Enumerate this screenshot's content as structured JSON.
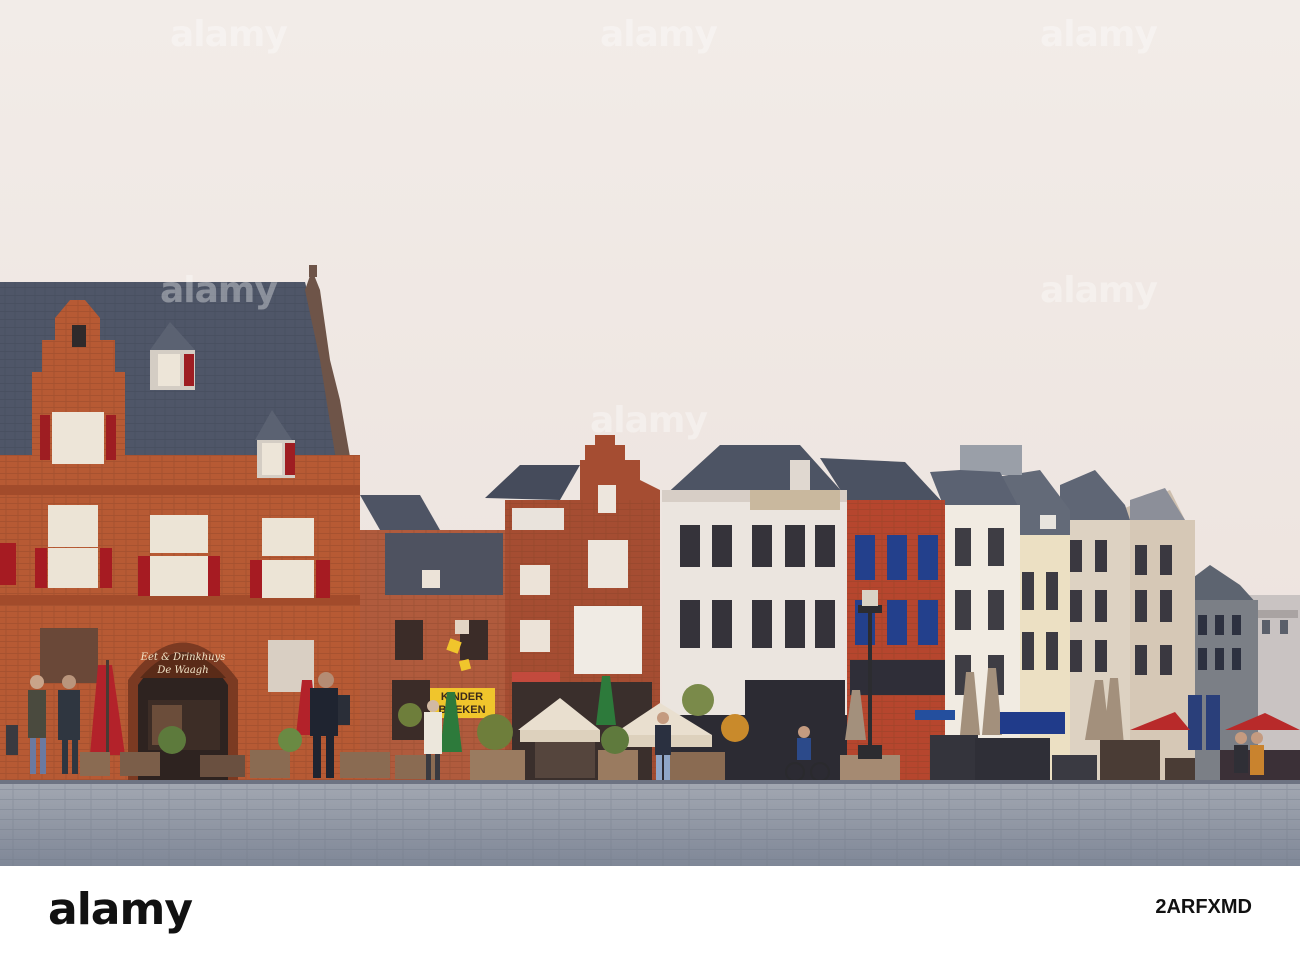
{
  "photo": {
    "sky_color": "#efe7e2",
    "pavement_color": "#8d95a4",
    "signs": {
      "restaurant_arch_line1": "Eet & Drinkhuys",
      "restaurant_arch_line2": "De Waagh",
      "kinder_line1": "KINDER",
      "kinder_line2": "BOEKEN"
    }
  },
  "footer": {
    "logo": "alamy",
    "image_id": "2ARFXMD"
  },
  "watermark": {
    "text": "alamy"
  }
}
